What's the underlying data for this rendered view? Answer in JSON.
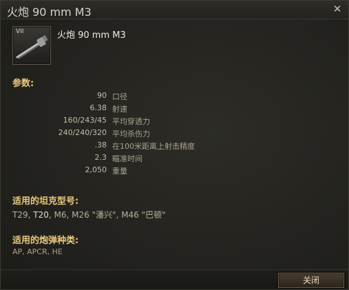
{
  "window": {
    "title": "火炮 90 mm M3",
    "close_icon": "close-icon"
  },
  "item": {
    "tier": "VII",
    "name": "火炮 90 mm M3",
    "icon": "gun-icon"
  },
  "params": {
    "heading": "参数:",
    "rows": [
      {
        "value": "90",
        "label": "口径"
      },
      {
        "value": "6.38",
        "label": "射速"
      },
      {
        "value": "160/243/45",
        "label": "平均穿透力"
      },
      {
        "value": "240/240/320",
        "label": "平均杀伤力"
      },
      {
        "value": ".38",
        "label": "在100米距离上射击精度"
      },
      {
        "value": "2.3",
        "label": "瞄准时间"
      },
      {
        "value": "2,050",
        "label": "重量"
      }
    ]
  },
  "tanks": {
    "heading": "适用的坦克型号:",
    "list_prefix": "T29, ",
    "list_highlight": "T20",
    "list_suffix": ", M6, M26 \"潘兴\", M46 \"巴顿\""
  },
  "ammo": {
    "heading": "适用的炮弹种类:",
    "list": "AP, APCR, HE"
  },
  "footer": {
    "close_label": "关闭"
  },
  "colors": {
    "heading": "#e9c97d",
    "text": "#b9b19c",
    "highlight": "#e4dcc6",
    "button_border": "#6e5a3c"
  }
}
